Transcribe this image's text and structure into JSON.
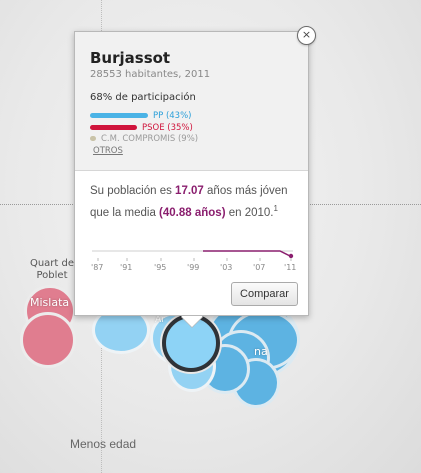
{
  "background": {
    "labels": {
      "quart": "Quart de\nPoblet",
      "mislata": "Mislata",
      "partial_right": "na",
      "partial_left": "Ar"
    },
    "axis_label": "Menos edad"
  },
  "popup": {
    "close_glyph": "×",
    "title": "Burjassot",
    "subtitle": "28553 habitantes, 2011",
    "participation": "68% de participación",
    "parties": [
      {
        "label": "PP (43%)",
        "share": 0.43,
        "color": "#4ab3e6",
        "text_color": "#2a9fd9"
      },
      {
        "label": "PSOE (35%)",
        "share": 0.35,
        "color": "#d0143c",
        "text_color": "#d0143c"
      },
      {
        "label": "C.M. COMPROMIS (9%)",
        "share": 0.09,
        "color": "#c9c3a8",
        "text_color": "#9a9a9a"
      }
    ],
    "otros": "OTROS",
    "description": {
      "part1": "Su población es ",
      "value1": "17.07",
      "part2": " años más jóven que la media ",
      "value2": "(40.88 años)",
      "part3": " en 2010.",
      "footnote": "1"
    },
    "timeline_years": [
      "'87",
      "'91",
      "'95",
      "'99",
      "'03",
      "'07",
      "'11"
    ],
    "compare_button": "Comparar"
  },
  "colors": {
    "highlight": "#8a1e6e",
    "accent_blue": "#5db3e2",
    "accent_red": "#e07d8f"
  }
}
